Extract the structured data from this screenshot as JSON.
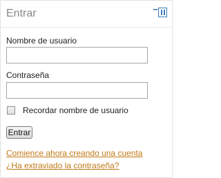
{
  "header": {
    "title": "Entrar",
    "dock_icon": "dock-toggle-icon"
  },
  "form": {
    "username_label": "Nombre de usuario",
    "username_value": "",
    "password_label": "Contraseña",
    "password_value": "",
    "remember_label": "Recordar nombre de usuario",
    "remember_checked": false,
    "submit_label": "Entrar"
  },
  "links": {
    "create_account": "Comience ahora creando una cuenta",
    "forgot_password": "¿Ha extraviado la contraseña?"
  },
  "colors": {
    "link": "#c07a16",
    "dock_icon": "#3a78b8",
    "title": "#888888"
  }
}
